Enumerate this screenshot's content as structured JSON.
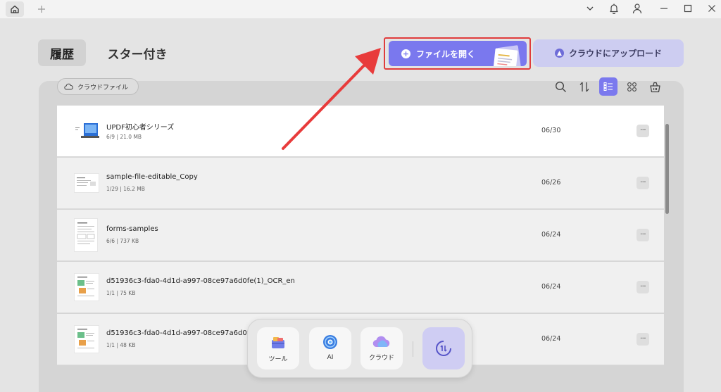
{
  "titlebar": {
    "icons": [
      "home-icon",
      "plus-icon",
      "chevron-down-icon",
      "bell-icon",
      "user-icon",
      "minimize-icon",
      "maximize-icon",
      "close-icon"
    ]
  },
  "tabs": [
    {
      "label": "履歴",
      "active": true
    },
    {
      "label": "スター付き",
      "active": false
    }
  ],
  "actions": {
    "open_file_label": "ファイルを開く",
    "upload_label": "クラウドにアップロード"
  },
  "filter": {
    "cloud_files_label": "クラウドファイル"
  },
  "toolbar": {
    "icons": [
      "search-icon",
      "sort-icon",
      "list-view-icon",
      "grid-view-icon",
      "basket-icon"
    ],
    "active_view": "list"
  },
  "files": [
    {
      "name": "UPDF初心者シリーズ",
      "meta": "6/9 | 21.0 MB",
      "date": "06/30"
    },
    {
      "name": "sample-file-editable_Copy",
      "meta": "1/29 | 16.2 MB",
      "date": "06/26"
    },
    {
      "name": "forms-samples",
      "meta": "6/6 | 737 KB",
      "date": "06/24"
    },
    {
      "name": "d51936c3-fda0-4d1d-a997-08ce97a6d0fe(1)_OCR_en",
      "meta": "1/1 | 75 KB",
      "date": "06/24"
    },
    {
      "name": "d51936c3-fda0-4d1d-a997-08ce97a6d0fe(1)",
      "meta": "1/1 | 48 KB",
      "date": "06/24"
    }
  ],
  "more_label": "···",
  "dock": {
    "tools_label": "ツール",
    "ai_label": "AI",
    "cloud_label": "クラウド"
  },
  "colors": {
    "accent": "#7a78ee",
    "upload_bg": "#cdcdf1",
    "highlight": "#e03c3c"
  }
}
